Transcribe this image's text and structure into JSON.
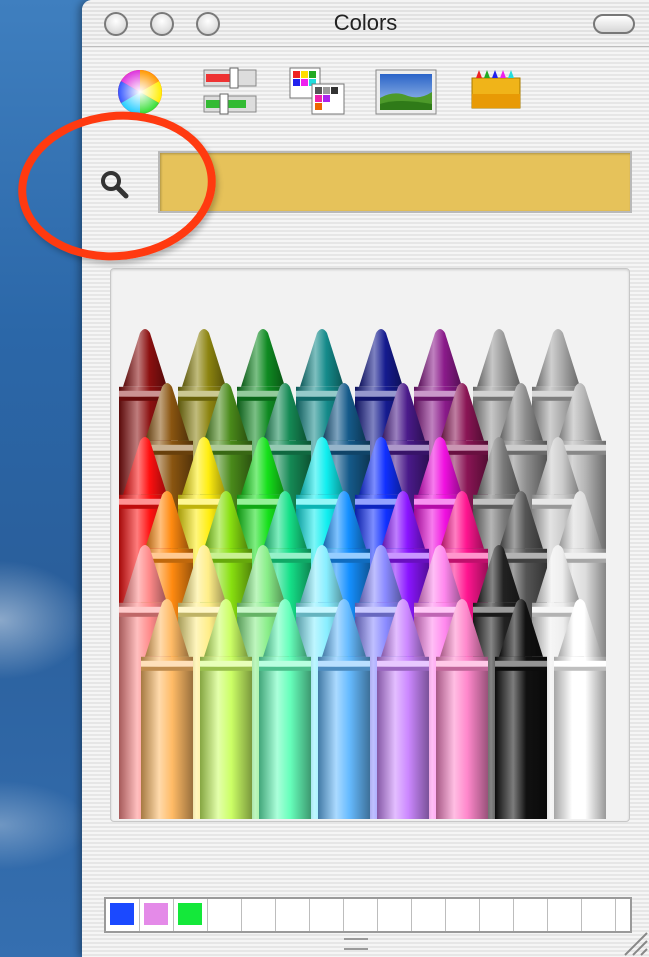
{
  "window": {
    "title": "Colors"
  },
  "toolbar": {
    "tools": [
      {
        "name": "color-wheel",
        "icon": "color-wheel-icon"
      },
      {
        "name": "color-sliders",
        "icon": "sliders-icon"
      },
      {
        "name": "color-palettes",
        "icon": "palettes-icon"
      },
      {
        "name": "image-palettes",
        "icon": "image-icon"
      },
      {
        "name": "crayons",
        "icon": "crayons-icon"
      }
    ]
  },
  "search": {
    "value": "",
    "swatch_color": "#e6c25a"
  },
  "crayons": {
    "rows": [
      [
        "#8b1010",
        "#8c8410",
        "#0f8a22",
        "#148a8a",
        "#151b8f",
        "#8a1a8a",
        "#9a9a9a",
        "#a8a8a8"
      ],
      [
        "#8a5510",
        "#4a8a1a",
        "#158a55",
        "#155a8a",
        "#4a1a8a",
        "#8a1555",
        "#8e8e8e",
        "#b5b5b5"
      ],
      [
        "#ff1010",
        "#ffee10",
        "#15e01a",
        "#10eef0",
        "#1030ff",
        "#f010e0",
        "#7a7a7a",
        "#cccccc"
      ],
      [
        "#ff8a10",
        "#88e010",
        "#15e088",
        "#1590ff",
        "#8a15ff",
        "#ff1590",
        "#555555",
        "#dddddd"
      ],
      [
        "#ff8a8a",
        "#ffee88",
        "#88ee88",
        "#88eeff",
        "#8a8aff",
        "#ff88ee",
        "#222222",
        "#eeeeee"
      ],
      [
        "#ffbb66",
        "#ccff66",
        "#66ffbb",
        "#66bbff",
        "#cc88ff",
        "#ff88cc",
        "#111111",
        "#ffffff"
      ]
    ]
  },
  "swatches": {
    "colors": [
      "#1b49ff",
      "#e48ae8",
      "#14e83a",
      "#ffffff",
      "#ffffff",
      "#ffffff",
      "#ffffff",
      "#ffffff",
      "#ffffff",
      "#ffffff",
      "#ffffff",
      "#ffffff",
      "#ffffff",
      "#ffffff",
      "#ffffff"
    ]
  },
  "annotation": {
    "color": "#ff3a10"
  }
}
